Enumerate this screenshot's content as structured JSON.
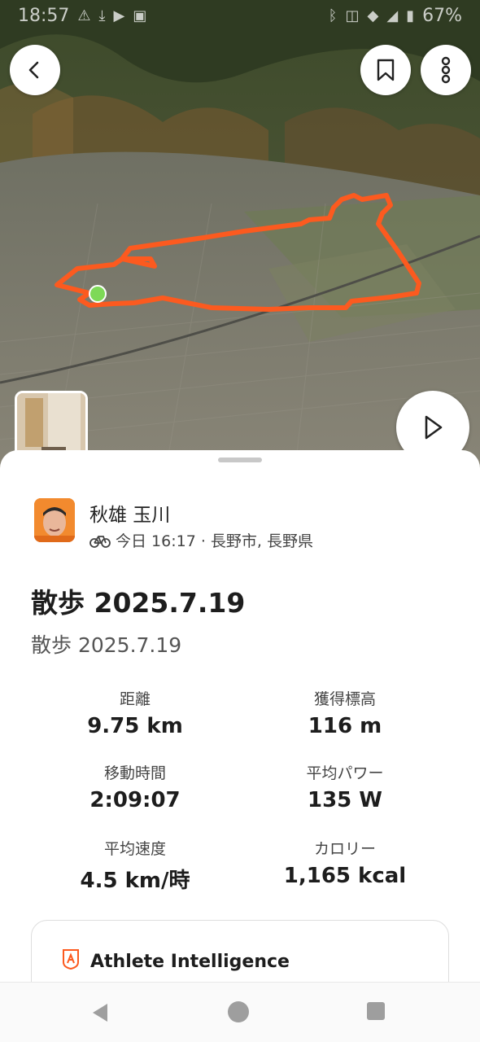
{
  "status_bar": {
    "time": "18:57",
    "battery": "67%"
  },
  "map": {
    "route_color": "#fc5a1f",
    "start_marker_color": "#7ed957"
  },
  "athlete": {
    "name": "秋雄 玉川",
    "activity_icon": "bike-icon",
    "meta": "今日 16:17 · 長野市, 長野県"
  },
  "activity": {
    "title": "散歩 2025.7.19",
    "description": "散歩 2025.7.19"
  },
  "stats": [
    {
      "label": "距離",
      "value": "9.75 km"
    },
    {
      "label": "獲得標高",
      "value": "116 m"
    },
    {
      "label": "移動時間",
      "value": "2:09:07"
    },
    {
      "label": "平均パワー",
      "value": "135 W"
    },
    {
      "label": "平均速度",
      "value": "4.5 km/時"
    },
    {
      "label": "カロリー",
      "value": "1,165 kcal"
    }
  ],
  "athlete_intelligence": {
    "title": "Athlete Intelligence"
  },
  "colors": {
    "brand_orange": "#fc5a1f",
    "text_dark": "#1d1d1d"
  }
}
